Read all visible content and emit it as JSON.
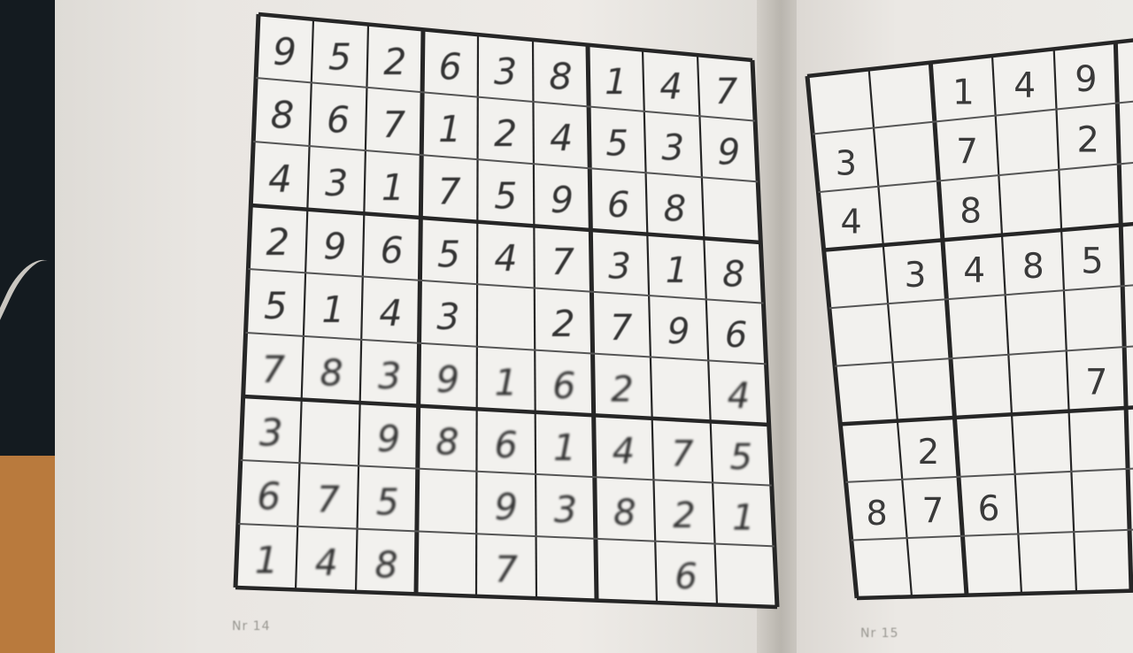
{
  "left_puzzle": {
    "label": "Nr 14",
    "rows": [
      [
        "9",
        "5",
        "2",
        "6",
        "3",
        "8",
        "1",
        "4",
        "7"
      ],
      [
        "8",
        "6",
        "7",
        "1",
        "2",
        "4",
        "5",
        "3",
        "9"
      ],
      [
        "4",
        "3",
        "1",
        "7",
        "5",
        "9",
        "6",
        "8",
        ""
      ],
      [
        "2",
        "9",
        "6",
        "5",
        "4",
        "7",
        "3",
        "1",
        "8"
      ],
      [
        "5",
        "1",
        "4",
        "3",
        "",
        "2",
        "7",
        "9",
        "6"
      ],
      [
        "7",
        "8",
        "3",
        "9",
        "1",
        "6",
        "2",
        "",
        "4"
      ],
      [
        "3",
        "",
        "9",
        "8",
        "6",
        "1",
        "4",
        "7",
        "5"
      ],
      [
        "6",
        "7",
        "5",
        "",
        "9",
        "3",
        "8",
        "2",
        "1"
      ],
      [
        "1",
        "4",
        "8",
        "",
        "7",
        "",
        "",
        "6",
        ""
      ]
    ]
  },
  "right_puzzle": {
    "label": "Nr 15",
    "rows": [
      [
        "",
        "",
        "1",
        "4",
        "9"
      ],
      [
        "3",
        "",
        "7",
        "",
        "2"
      ],
      [
        "4",
        "",
        "8",
        "",
        ""
      ],
      [
        "",
        "3",
        "4",
        "8",
        "5"
      ],
      [
        "",
        "",
        "",
        "",
        ""
      ],
      [
        "",
        "",
        "",
        "",
        "7"
      ],
      [
        "",
        "2",
        "",
        "",
        ""
      ],
      [
        "8",
        "7",
        "6",
        "",
        ""
      ],
      [
        "",
        "",
        "",
        "",
        ""
      ]
    ]
  }
}
